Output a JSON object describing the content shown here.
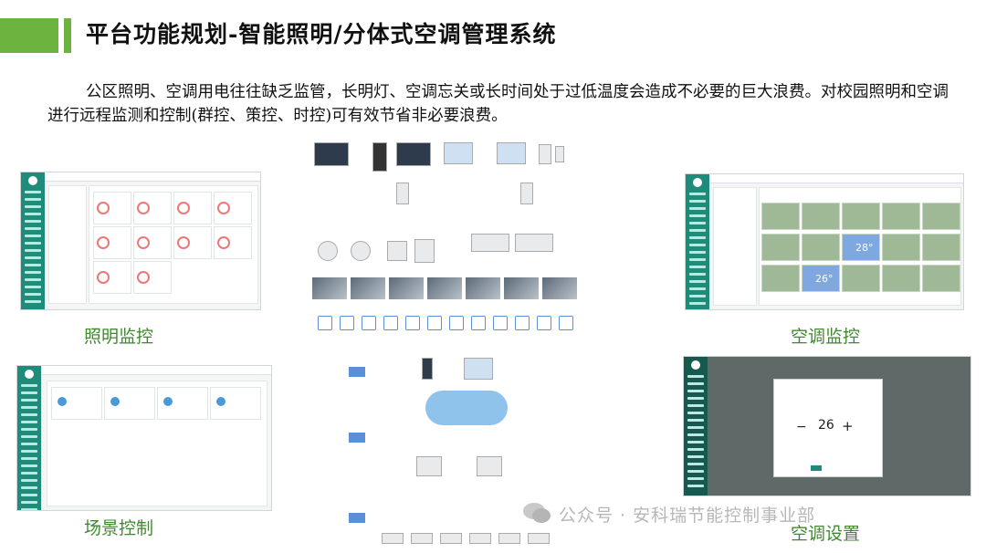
{
  "header": {
    "title": "平台功能规划-智能照明/分体式空调管理系统"
  },
  "intro": "公区照明、空调用电往往缺乏监管，长明灯、空调忘关或长时间处于过低温度会造成不必要的巨大浪费。对校园照明和空调进行远程监测和控制(群控、策控、时控)可有效节省非必要浪费。",
  "captions": {
    "lighting_monitor": "照明监控",
    "ac_monitor": "空调监控",
    "scene_control": "场景控制",
    "ac_settings": "空调设置"
  },
  "ac_monitor_temps": [
    "28°",
    "26°"
  ],
  "ac_settings_value": "26",
  "watermark": "公众号 · 安科瑞节能控制事业部",
  "colors": {
    "accent": "#6db33f",
    "caption": "#3f8a2c",
    "sidebar": "#1f8b7a"
  }
}
